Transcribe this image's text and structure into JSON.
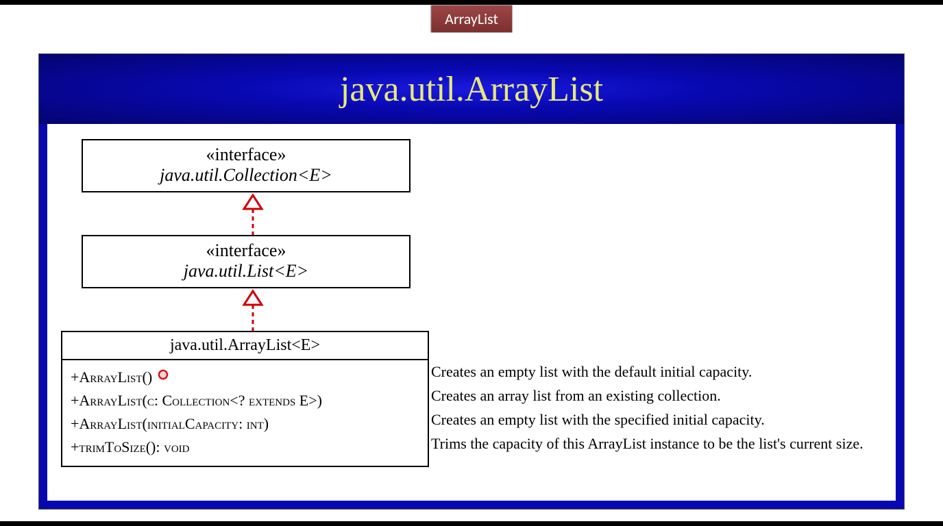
{
  "tab_label": "ArrayList",
  "slide_title": "java.util.ArrayList",
  "uml": {
    "collection": {
      "stereotype": "«interface»",
      "name": "java.util.Collection<E>"
    },
    "list": {
      "stereotype": "«interface»",
      "name": "java.util.List<E>"
    },
    "arraylist": {
      "name": "java.util.ArrayList<E>",
      "methods": [
        "+ArrayList()",
        "+ArrayList(c: Collection<? extends E>)",
        "+ArrayList(initialCapacity: int)",
        "+trimToSize(): void"
      ]
    }
  },
  "descriptions": [
    "Creates an empty list with the default initial capacity.",
    "Creates an array list from an existing collection.",
    "Creates an empty list with the specified initial capacity.",
    "Trims the capacity of this ArrayList instance to be the list's current size."
  ],
  "colors": {
    "tab_bg": "#8B3A3A",
    "header_accent": "#E8E87A",
    "header_bg": "#0808b0",
    "arrow": "#d00000"
  }
}
